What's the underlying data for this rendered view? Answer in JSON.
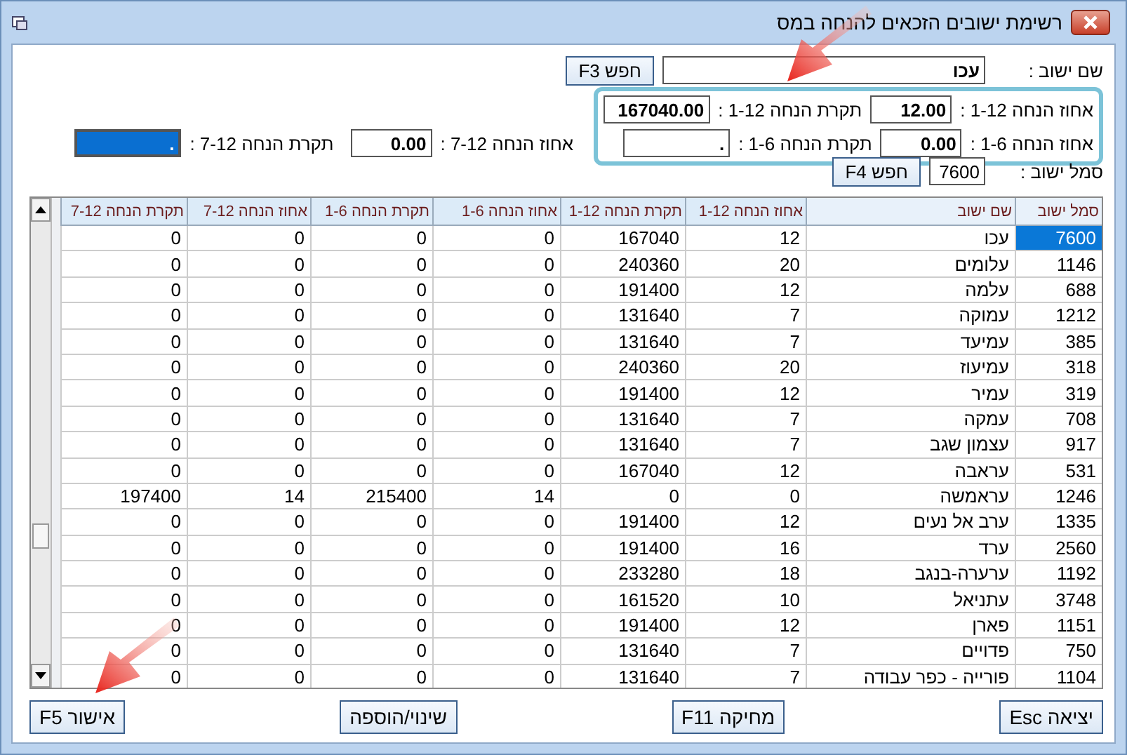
{
  "window": {
    "title": "רשימת ישובים הזכאים להנחה במס"
  },
  "name_search": {
    "label": "שם ישוב :",
    "value": "עכו",
    "button": "חפש F3"
  },
  "discount_rows": [
    {
      "group_fields": [
        {
          "label": "אחוז הנחה 1-12 :",
          "value": "12.00",
          "selected": false
        },
        {
          "label": "תקרת הנחה 1-12 :",
          "value": "167040.00",
          "selected": false
        }
      ]
    },
    {
      "group_fields": [
        {
          "label": "אחוז הנחה 1-6 :",
          "value": "0.00",
          "selected": false
        },
        {
          "label": "תקרת הנחה 1-6 :",
          "value": ".",
          "selected": false
        }
      ],
      "fields": [
        {
          "label": "אחוז הנחה 7-12 :",
          "value": "0.00",
          "selected": false
        },
        {
          "label": "תקרת הנחה 7-12 :",
          "value": ".",
          "selected": true
        }
      ]
    }
  ],
  "code_search": {
    "label": "סמל ישוב :",
    "value": "7600",
    "button": "חפש F4"
  },
  "table": {
    "columns": [
      "סמל ישוב",
      "שם ישוב",
      "אחוז הנחה 1-12",
      "תקרת הנחה 1-12",
      "אחוז הנחה 1-6",
      "תקרת הנחה 1-6",
      "אחוז הנחה 7-12",
      "תקרת הנחה 7-12"
    ],
    "rows": [
      {
        "selected": true,
        "cells": [
          "7600",
          "עכו",
          "12",
          "167040",
          "0",
          "0",
          "0",
          "0"
        ]
      },
      {
        "selected": false,
        "cells": [
          "1146",
          "עלומים",
          "20",
          "240360",
          "0",
          "0",
          "0",
          "0"
        ]
      },
      {
        "selected": false,
        "cells": [
          "688",
          "עלמה",
          "12",
          "191400",
          "0",
          "0",
          "0",
          "0"
        ]
      },
      {
        "selected": false,
        "cells": [
          "1212",
          "עמוקה",
          "7",
          "131640",
          "0",
          "0",
          "0",
          "0"
        ]
      },
      {
        "selected": false,
        "cells": [
          "385",
          "עמיעד",
          "7",
          "131640",
          "0",
          "0",
          "0",
          "0"
        ]
      },
      {
        "selected": false,
        "cells": [
          "318",
          "עמיעוז",
          "20",
          "240360",
          "0",
          "0",
          "0",
          "0"
        ]
      },
      {
        "selected": false,
        "cells": [
          "319",
          "עמיר",
          "12",
          "191400",
          "0",
          "0",
          "0",
          "0"
        ]
      },
      {
        "selected": false,
        "cells": [
          "708",
          "עמקה",
          "7",
          "131640",
          "0",
          "0",
          "0",
          "0"
        ]
      },
      {
        "selected": false,
        "cells": [
          "917",
          "עצמון שגב",
          "7",
          "131640",
          "0",
          "0",
          "0",
          "0"
        ]
      },
      {
        "selected": false,
        "cells": [
          "531",
          "עראבה",
          "12",
          "167040",
          "0",
          "0",
          "0",
          "0"
        ]
      },
      {
        "selected": false,
        "cells": [
          "1246",
          "עראמשה",
          "0",
          "0",
          "14",
          "215400",
          "14",
          "197400"
        ]
      },
      {
        "selected": false,
        "cells": [
          "1335",
          "ערב אל נעים",
          "12",
          "191400",
          "0",
          "0",
          "0",
          "0"
        ]
      },
      {
        "selected": false,
        "cells": [
          "2560",
          "ערד",
          "16",
          "191400",
          "0",
          "0",
          "0",
          "0"
        ]
      },
      {
        "selected": false,
        "cells": [
          "1192",
          "ערערה-בנגב",
          "18",
          "233280",
          "0",
          "0",
          "0",
          "0"
        ]
      },
      {
        "selected": false,
        "cells": [
          "3748",
          "עתניאל",
          "10",
          "161520",
          "0",
          "0",
          "0",
          "0"
        ]
      },
      {
        "selected": false,
        "cells": [
          "1151",
          "פארן",
          "12",
          "191400",
          "0",
          "0",
          "0",
          "0"
        ]
      },
      {
        "selected": false,
        "cells": [
          "750",
          "פדויים",
          "7",
          "131640",
          "0",
          "0",
          "0",
          "0"
        ]
      },
      {
        "selected": false,
        "cells": [
          "1104",
          "פורייה - כפר עבודה",
          "7",
          "131640",
          "0",
          "0",
          "0",
          "0"
        ]
      }
    ]
  },
  "buttons": [
    "יציאה Esc",
    "מחיקה F11",
    "שינוי/הוספה",
    "אישור F5"
  ]
}
